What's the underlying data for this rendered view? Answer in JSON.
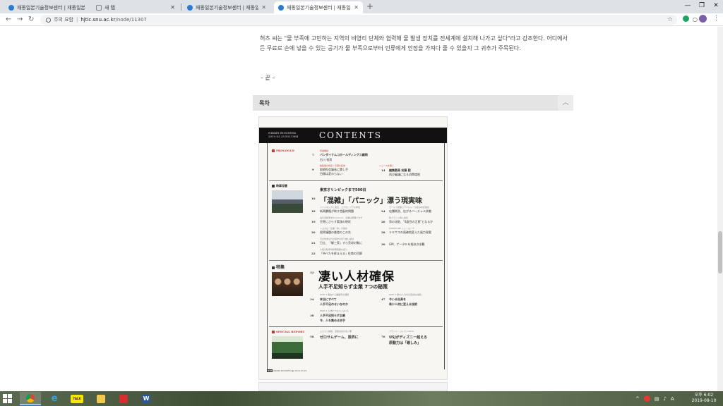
{
  "browser": {
    "tabs": [
      {
        "title": "재동일본기술정보센터 | 재동일본",
        "active": false
      },
      {
        "title": "새 탭",
        "active": false
      },
      {
        "title": "재동일본기술정보센터 | 재동일본",
        "active": false
      },
      {
        "title": "재동일본기술정보센터 | 재동일본",
        "active": true
      }
    ],
    "new_tab": "+",
    "address": {
      "security_label": "주의 요함",
      "host": "hjtic.snu.ac.kr",
      "path": "/node/11307"
    }
  },
  "article": {
    "paragraph": "허츠 씨는 \"물 부족에 고민하는 지역의 비영리 단체와 협력해 물 발생 장치를 전세계에 설치해 나가고 싶다\"라고 강조한다. 어디에서든 무료로 손에 넣을 수 있는 공기가 물 부족으로부터 인류에게 안정을 가져다 줄 수 있을지 그 귀추가 주목된다.",
    "end_mark": "– 끝 –"
  },
  "toc": {
    "label": "목차",
    "toggle_icon": "chevron-up-icon"
  },
  "magazine": {
    "brand": "NIKKEI BUSINESS",
    "issue": "2019.03.25 NO.1984",
    "title": "CONTENTS",
    "prologue": {
      "tag": "PROLOGUE",
      "items": [
        {
          "page": "7",
          "kicker": "有訓無訓",
          "title": "バンダイナムコホールディングス顧問",
          "sub": "石川 祝男"
        },
        {
          "page": "9",
          "kicker": "編集長の視点 / 今週の名言",
          "title": "取締役会議長に関し手",
          "sub": "目標は変わらない"
        },
        {
          "page": "14",
          "kicker": "ニュースを突く",
          "title": "編集委員 安藤 毅",
          "sub": "再び審議になる消費増税"
        }
      ]
    },
    "special_feature_tag": "時事深層",
    "lead_title": "東京オリンピックまで500日",
    "big_title": "「混雑」「パニック」漂う現実味",
    "news_items": [
      {
        "page": "18",
        "kicker": "インドネシアに進出、エクセレブアも参加",
        "title": "新興覇権が映す首脳的問題"
      },
      {
        "page": "19",
        "kicker": "電気自動車をBroadcom、企業は整理できず",
        "title": "世界にさらす実践の現状"
      },
      {
        "page": "20",
        "kicker": "トヨタは「企業一体」を強化",
        "title": "限界議題の着陸のこの先"
      },
      {
        "page": "21",
        "kicker": "日立化成は日立製作の切り離し検討",
        "title": "日立、「御三家」すら売却対象に"
      },
      {
        "page": "22",
        "kicker": "大型の駐車場整備事業を巡り",
        "title": "「待べたを拝まえる」住商の目算"
      },
      {
        "page": "24",
        "kicker": "セールス攻撃にアバルシーの拒み対応強化",
        "title": "店舗刷洗、広がるバーチャル試着"
      },
      {
        "page": "26",
        "kicker": "新ブランド導入強化",
        "title": "男の化粧、\"4度目の正直\"となるか"
      },
      {
        "page": "28",
        "kicker": "FRONTLINE ニューヨーク",
        "title": "テキサスの過疎地変えた風力発電"
      },
      {
        "page": "30",
        "kicker": "",
        "title": "GM、ゲータルを指決き非難"
      }
    ],
    "feature_tag": "特集",
    "feature_page": "32",
    "feature_title": "凄い人材確保",
    "feature_sub": "人手不足知らず企業 7つの秘策",
    "feature_items": [
      {
        "page": "34",
        "kicker": "PART 1 解決する業績界の課題",
        "title": "本当にすべて",
        "sub": "人手不足のせいなのか"
      },
      {
        "page": "38",
        "kicker": "PART 2 人材をつなぐにはいる",
        "title": "人手不足知らず企業",
        "sub": "今、人を集める妙手"
      },
      {
        "page": "47",
        "kicker": "PART 3 優れた人材の活性化[採用]",
        "title": "今いる社員を",
        "sub": "希少人材に変える技術"
      }
    ],
    "special_report_tag": "SPECIAL REPORT",
    "report_items": [
      {
        "page": "58",
        "kicker": "ふるさと納税、宮阪島県の功と罪",
        "title": "ゼロサムゲーム、限界に"
      },
      {
        "page": "76",
        "kicker": "ブランド・ジャパン2019",
        "title": "USJがディズニー超える",
        "sub": "原動力は「親しみ」"
      }
    ],
    "footer_page": "010",
    "footer_text": "NIKKEI BUSINESS ▶ 2019.03.25"
  },
  "taskbar": {
    "apps": [
      "chrome",
      "ie",
      "kakaotalk",
      "explorer",
      "acrobat",
      "word"
    ],
    "kakao_label": "TALK",
    "clock_time": "오후 6:02",
    "clock_date": "2019-08-10"
  }
}
